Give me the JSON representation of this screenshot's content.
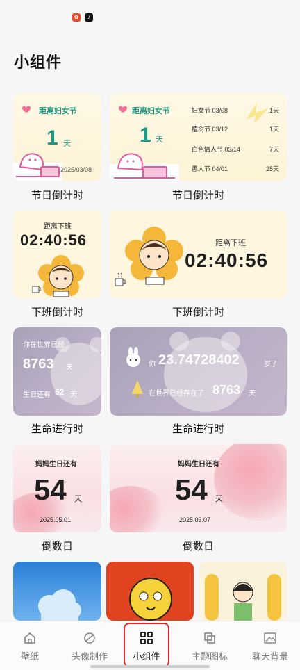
{
  "page": {
    "title": "小组件"
  },
  "status_bar": {
    "icons": [
      "app-icon-red",
      "tiktok-icon"
    ]
  },
  "widgets": {
    "festival_small": {
      "title": "距离妇女节",
      "count": "1",
      "unit": "天",
      "date": "2025/03/08",
      "caption": "节日倒计时"
    },
    "festival_large": {
      "title": "距离妇女节",
      "count": "1",
      "unit": "天",
      "caption": "节日倒计时",
      "rows": [
        {
          "name": "妇女节 03/08",
          "days": "1天"
        },
        {
          "name": "植树节 03/12",
          "days": "1天"
        },
        {
          "name": "白色情人节 03/14",
          "days": "7天"
        },
        {
          "name": "愚人节 04/01",
          "days": "25天"
        }
      ]
    },
    "offwork_small": {
      "label": "距离下班",
      "time": "02:40:56",
      "caption": "下班倒计时"
    },
    "offwork_large": {
      "label": "距离下班",
      "time": "02:40:56",
      "caption": "下班倒计时"
    },
    "life_small": {
      "line1": "你在世界已经",
      "days": "8763",
      "unit": "天",
      "bday_prefix": "生日还有",
      "bday_days": "62",
      "bday_unit": "天",
      "caption": "生命进行时"
    },
    "life_large": {
      "prefix": "你",
      "years": "23.74728402",
      "years_unit": "岁了",
      "line2": "在世界已经存在了",
      "days": "8763",
      "unit": "天",
      "caption": "生命进行时"
    },
    "countdown_small": {
      "title": "妈妈生日还有",
      "num": "54",
      "unit": "天",
      "date": "2025.05.01",
      "caption": "倒数日"
    },
    "countdown_large": {
      "title": "妈妈生日还有",
      "num": "54",
      "unit": "天",
      "date": "2025.03.07",
      "caption": "倒数日"
    }
  },
  "bottom_nav": {
    "items": [
      {
        "label": "壁纸",
        "icon": "house-icon"
      },
      {
        "label": "头像制作",
        "icon": "planet-icon"
      },
      {
        "label": "小组件",
        "icon": "grid-icon"
      },
      {
        "label": "主题图标",
        "icon": "layers-icon"
      },
      {
        "label": "聊天背景",
        "icon": "image-icon"
      }
    ],
    "active_index": 2
  },
  "colors": {
    "accent_green": "#1e9a84",
    "highlight_red": "#e3262d",
    "festival_bg": "#fdf3d6"
  }
}
